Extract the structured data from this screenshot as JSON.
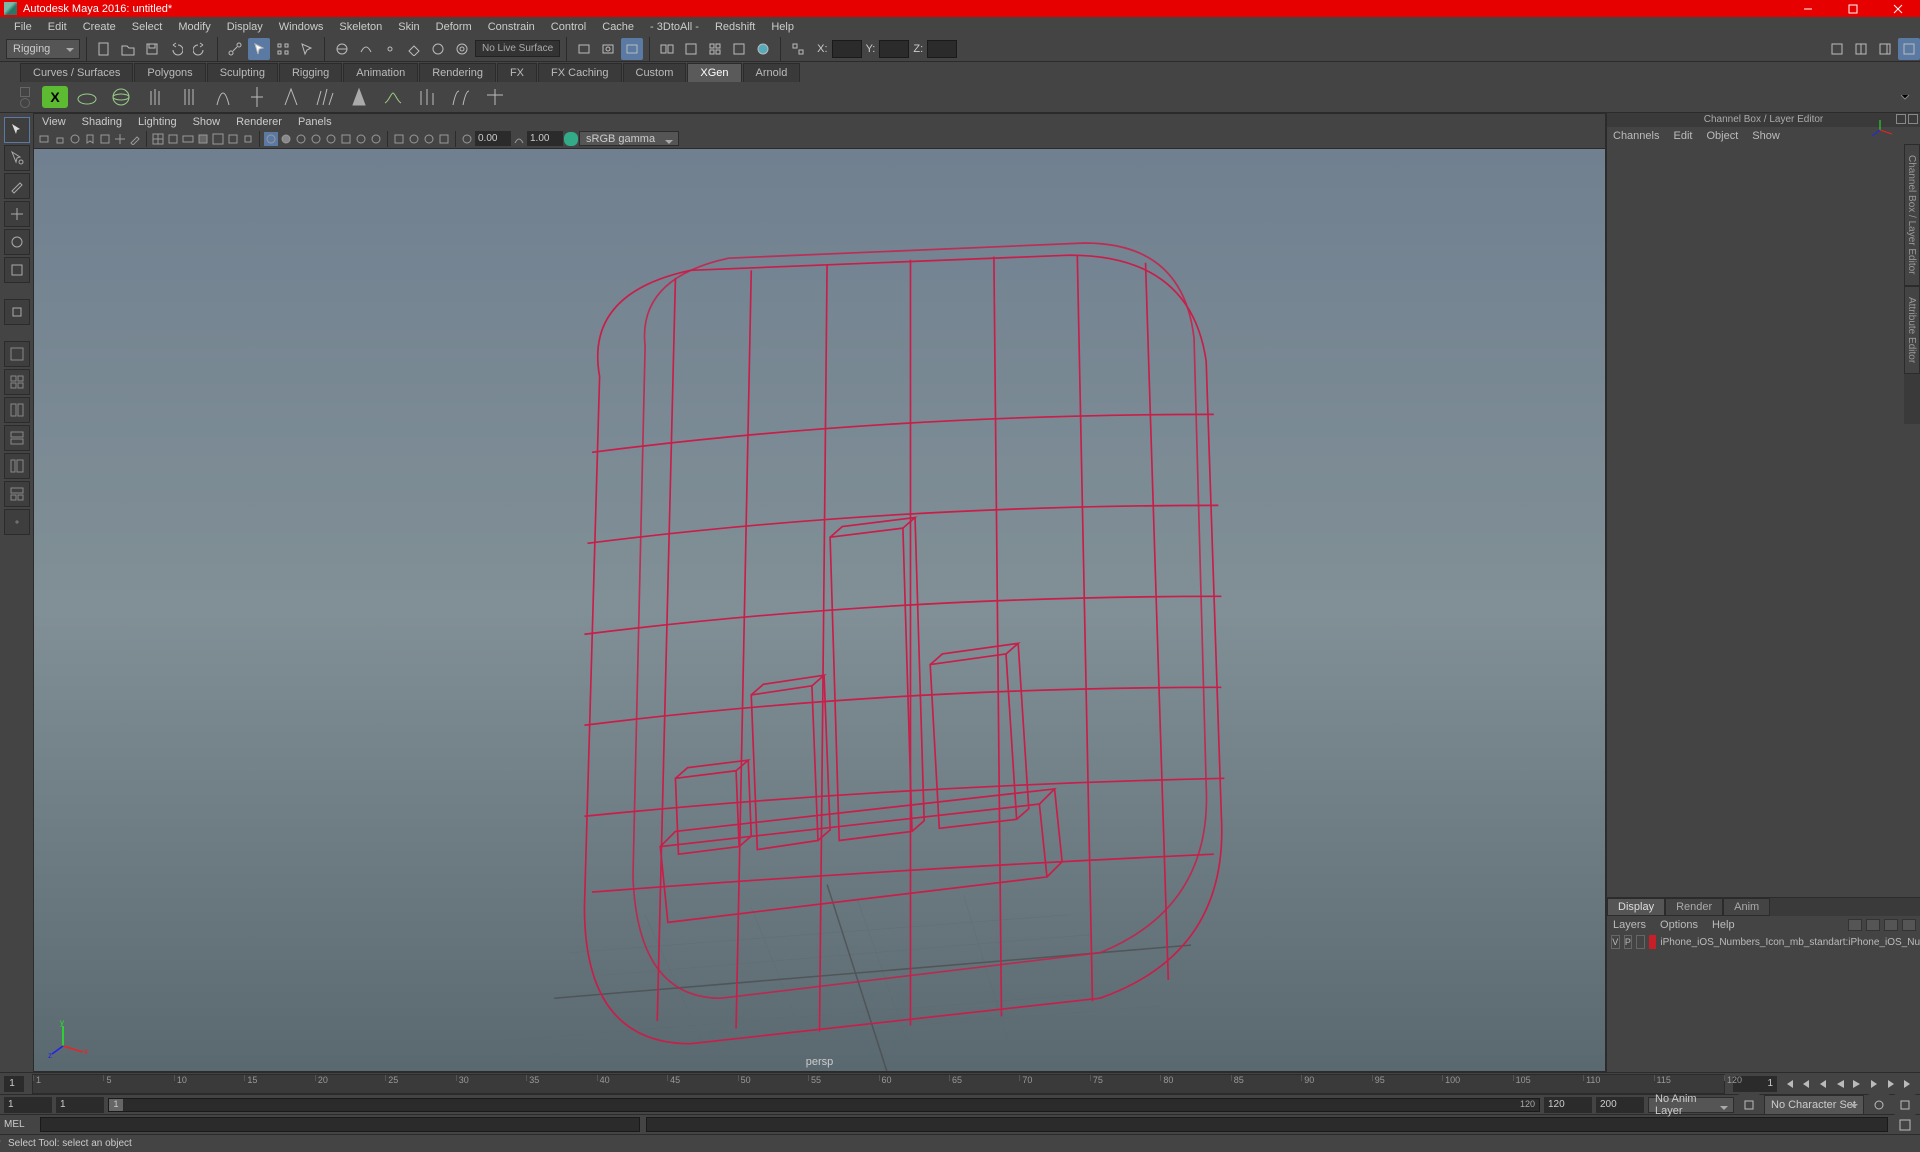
{
  "title": "Autodesk Maya 2016: untitled*",
  "menus": [
    "File",
    "Edit",
    "Create",
    "Select",
    "Modify",
    "Display",
    "Windows",
    "Skeleton",
    "Skin",
    "Deform",
    "Constrain",
    "Control",
    "Cache",
    "- 3DtoAll -",
    "Redshift",
    "Help"
  ],
  "mode_dropdown": "Rigging",
  "no_live": "No Live Surface",
  "xyz": {
    "x": "X:",
    "y": "Y:",
    "z": "Z:"
  },
  "shelf_tabs": [
    "Curves / Surfaces",
    "Polygons",
    "Sculpting",
    "Rigging",
    "Animation",
    "Rendering",
    "FX",
    "FX Caching",
    "Custom",
    "XGen",
    "Arnold"
  ],
  "active_shelf_tab": "XGen",
  "panel_menus": [
    "View",
    "Shading",
    "Lighting",
    "Show",
    "Renderer",
    "Panels"
  ],
  "exposure": "0.00",
  "gamma": "1.00",
  "color_mgmt": "sRGB gamma",
  "camera": "persp",
  "channelbox": {
    "title": "Channel Box / Layer Editor",
    "tabs_right": [
      "Channel Box / Layer Editor",
      "Attribute Editor"
    ],
    "menus": [
      "Channels",
      "Edit",
      "Object",
      "Show"
    ]
  },
  "layers": {
    "tabs": [
      "Display",
      "Render",
      "Anim"
    ],
    "active": "Display",
    "menus": [
      "Layers",
      "Options",
      "Help"
    ],
    "row": {
      "v": "V",
      "p": "P",
      "name": "iPhone_iOS_Numbers_Icon_mb_standart:iPhone_iOS_Nu"
    }
  },
  "timeline": {
    "ticks": [
      "1",
      "5",
      "10",
      "15",
      "20",
      "25",
      "30",
      "35",
      "40",
      "45",
      "50",
      "55",
      "60",
      "65",
      "70",
      "75",
      "80",
      "85",
      "90",
      "95",
      "100",
      "105",
      "110",
      "115",
      "120"
    ],
    "current": "1",
    "range_start": "1",
    "range_end": "120",
    "range_outer_start": "1",
    "range_outer_end": "200",
    "anim_layer": "No Anim Layer",
    "char_set": "No Character Set",
    "slider_handle": "1",
    "slider_end": "120"
  },
  "cmd": {
    "label": "MEL"
  },
  "helpline": "Select Tool: select an object"
}
